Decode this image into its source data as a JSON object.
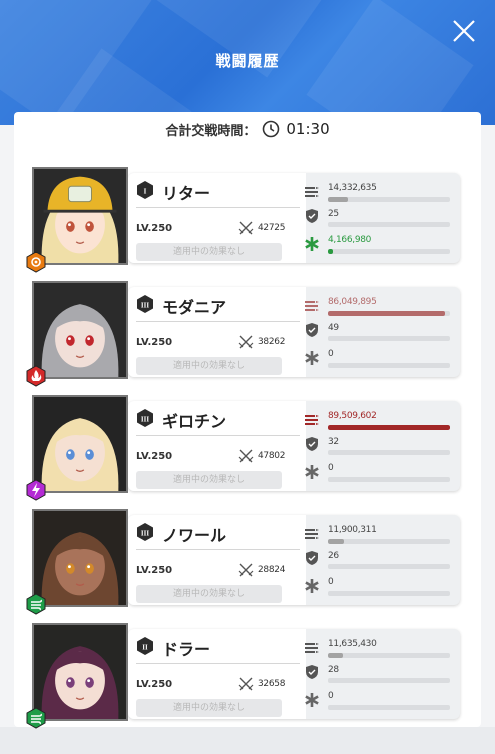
{
  "header": {
    "title": "戦闘履歴"
  },
  "summary": {
    "label": "合計交戦時間：",
    "time": "01:30"
  },
  "characters": [
    {
      "name": "リター",
      "burst": "I",
      "level": "LV.250",
      "power": "42725",
      "effects": "適用中の効果なし",
      "element": "iron",
      "element_color": "#e87a10",
      "damage": "14,332,635",
      "damage_pct": 0.16,
      "damage_color": "#a3a3a3",
      "taken": "25",
      "taken_pct": 0.0,
      "heal": "4,166,980",
      "heal_pct": 0.04,
      "heal_color": "#2a9a40",
      "heal_active": true
    },
    {
      "name": "モダニア",
      "burst": "III",
      "level": "LV.250",
      "power": "38262",
      "effects": "適用中の効果なし",
      "element": "fire",
      "element_color": "#d42a2a",
      "damage": "86,049,895",
      "damage_pct": 0.96,
      "damage_color": "#b36b6b",
      "taken": "49",
      "taken_pct": 0.0,
      "heal": "0",
      "heal_pct": 0.0,
      "heal_color": "#2a9a40",
      "heal_active": false
    },
    {
      "name": "ギロチン",
      "burst": "III",
      "level": "LV.250",
      "power": "47802",
      "effects": "適用中の効果なし",
      "element": "electric",
      "element_color": "#b42ad4",
      "damage": "89,509,602",
      "damage_pct": 1.0,
      "damage_color": "#a22828",
      "taken": "32",
      "taken_pct": 0.0,
      "heal": "0",
      "heal_pct": 0.0,
      "heal_color": "#2a9a40",
      "heal_active": false
    },
    {
      "name": "ノワール",
      "burst": "III",
      "level": "LV.250",
      "power": "28824",
      "effects": "適用中の効果なし",
      "element": "wind",
      "element_color": "#1e9c48",
      "damage": "11,900,311",
      "damage_pct": 0.13,
      "damage_color": "#a3a3a3",
      "taken": "26",
      "taken_pct": 0.0,
      "heal": "0",
      "heal_pct": 0.0,
      "heal_color": "#2a9a40",
      "heal_active": false
    },
    {
      "name": "ドラー",
      "burst": "II",
      "level": "LV.250",
      "power": "32658",
      "effects": "適用中の効果なし",
      "element": "wind",
      "element_color": "#1e9c48",
      "damage": "11,635,430",
      "damage_pct": 0.12,
      "damage_color": "#a3a3a3",
      "taken": "28",
      "taken_pct": 0.0,
      "heal": "0",
      "heal_pct": 0.0,
      "heal_color": "#2a9a40",
      "heal_active": false
    }
  ]
}
